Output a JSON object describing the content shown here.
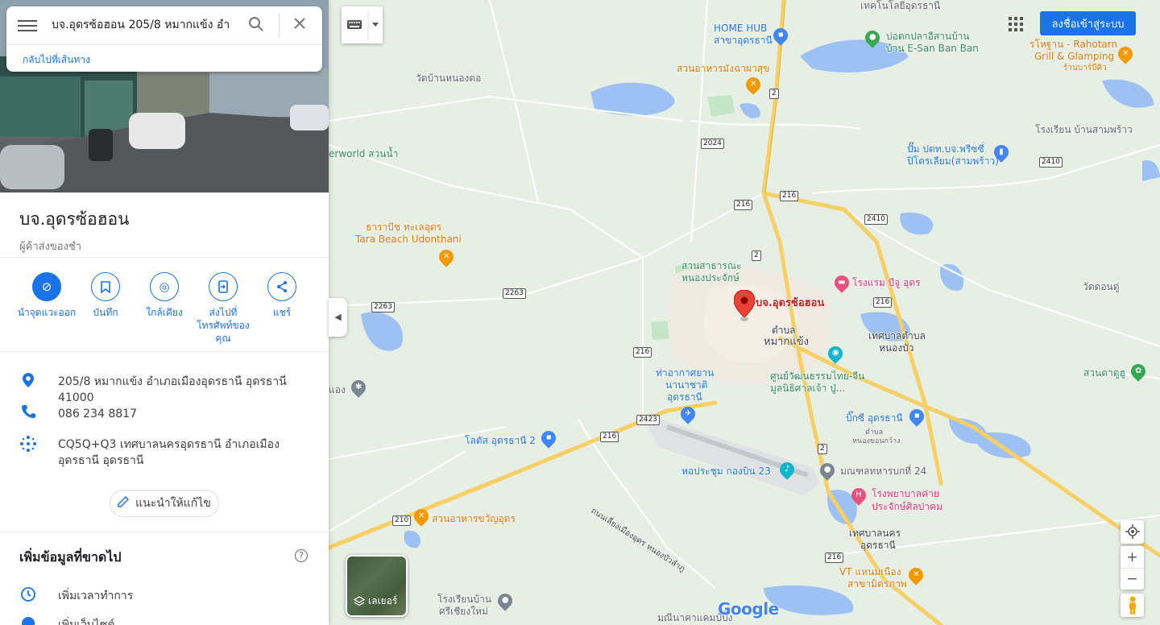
{
  "search": {
    "query": "บจ.อุดรซ้อฮอน 205/8 หมากแข้ง อำ",
    "back_link": "กลับไปที่เส้นทาง"
  },
  "place": {
    "name": "บจ.อุดรซ้อฮอน",
    "category": "ผู้ค้าส่งของชำ"
  },
  "actions": [
    {
      "label": "นำจุดแวะออก",
      "icon": "remove-stop-icon"
    },
    {
      "label": "บันทึก",
      "icon": "bookmark-icon"
    },
    {
      "label": "ใกล้เคียง",
      "icon": "nearby-icon"
    },
    {
      "label": "ส่งไปที่โทรศัพท์ของคุณ",
      "icon": "send-to-phone-icon"
    },
    {
      "label": "แชร์",
      "icon": "share-icon"
    }
  ],
  "info": {
    "address": "205/8 หมากแข้ง อำเภอเมืองอุดรธานี อุดรธานี 41000",
    "phone": "086 234 8817",
    "plus_code": "CQ5Q+Q3 เทศบาลนครอุดรธานี อำเภอเมืองอุดรธานี อุดรธานี"
  },
  "suggest_edit": "แนะนำให้แก้ไข",
  "missing": {
    "title": "เพิ่มข้อมูลที่ขาดไป",
    "hours": "เพิ่มเวลาทำการ",
    "website": "เพิ่มเว็บไซต์"
  },
  "top_right": {
    "signin": "ลงชื่อเข้าสู่ระบบ"
  },
  "layers_label": "เลเยอร์",
  "google_logo": "Google",
  "map_labels": {
    "home_hub": "HOME HUB",
    "home_hub_sub": "สาขาอุดรธานี",
    "technology": "เทคโนโลยีอุดรธานี",
    "fishpond": "บ่อตกปลาอีสานบ้าน",
    "fishpond_sub": "บ้าน E-San Ban Ban",
    "rahotarn": "รโหฐาน - Rahotarn",
    "rahotarn_sub": "Grill & Glamping",
    "rahotarn_sub2": "ร้านบาร์บีคิว",
    "wat_nongtho": "วัดบ้านหนองตอ",
    "restaurant_mangkhut": "สวนอาหารมังฉาผาสุข",
    "waterworld": "erworld สวนน้ำ",
    "school_sampraw": "โรงเรียน บ้านสามพร้าว",
    "ptt": "ปั๊ม ปตท.บจ.พรีซซี่",
    "ptt_sub": "ปิโตรเลียม(สามพร้าว)",
    "tara": "ธาราบีช ทะเลอุดร",
    "tara_en": "Tara Beach Udonthani",
    "park": "สวนสาธารณะ",
    "park_sub": "หนองประจักษ์",
    "hotel_bijoo": "โรงแรม บีจู อุดร",
    "wat_dondu": "วัดดอนดู่",
    "marker": "บจ.อุดรซ้อฮอน",
    "tambon": "ตำบล",
    "tambon_name": "หมากแข้ง",
    "municipality_nongbua": "เทศบาลตำบล",
    "municipality_nongbua_sub": "หนองบัว",
    "airport": "ท่าอากาศยาน",
    "airport_sub": "นานาชาติ",
    "airport_sub2": "อุดรธานี",
    "cultural": "ศูนย์วัฒนธรรมไทย-จีน",
    "cultural_sub": "มูลนิธิศาลเจ้า ปู่...",
    "ptt_big_c": "บิ๊กซี อุดรธานี",
    "ptt_big_c_sub": "ตำบล",
    "ptt_big_c_sub2": "หนองขอนกว้าง",
    "park_right": "สวนตาดูฮู",
    "lotus": "โลตัส อุดรธานี 2",
    "concert": "หอประชุม กองบิน 23",
    "wing24": "มณฑลทหารบกที่ 24",
    "hospital": "โรงพยาบาลค่าย",
    "hospital_sub": "ประจักษ์ศิลปาคม",
    "restaurant_khwan": "สวนอาหารขวัญอุดร",
    "highway_label": "ถนนเลี่ยงเมืองอุดร หนองบัวลำภู",
    "municipality_city": "เทศบาลนคร",
    "municipality_city_sub": "อุดรธานี",
    "vt": "VT แหนมเนือง",
    "vt_sub": "สาขามิตรภาพ",
    "school_sichiangmai": "โรงเรียนบ้าน",
    "school_sichiangmai_sub": "ศรีเชียงใหม่",
    "maninak": "มณีนาคาแคมป์ปิ้ง",
    "wat_left": "แอง"
  },
  "road_shields": [
    "2",
    "2024",
    "216",
    "216",
    "2410",
    "2410",
    "2",
    "2263",
    "2263",
    "216",
    "216",
    "2423",
    "216",
    "2",
    "210",
    "216"
  ]
}
